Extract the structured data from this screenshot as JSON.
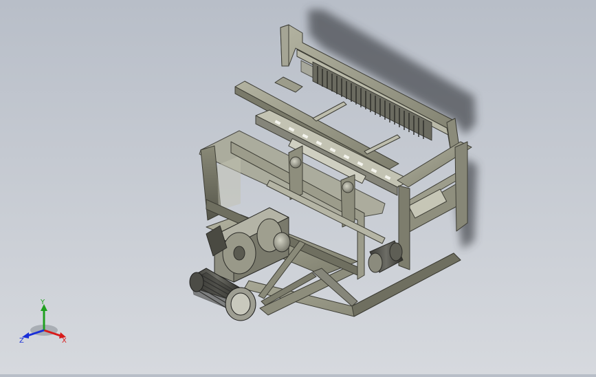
{
  "viewport": {
    "background_top": "#b8bec8",
    "background_bottom": "#d6d9de",
    "model_color": "#9a9a88"
  },
  "triad": {
    "x_label": "X",
    "y_label": "Y",
    "z_label": "Z",
    "x_color": "#d81a1a",
    "y_color": "#1fa01f",
    "z_color": "#1a2fd8"
  }
}
